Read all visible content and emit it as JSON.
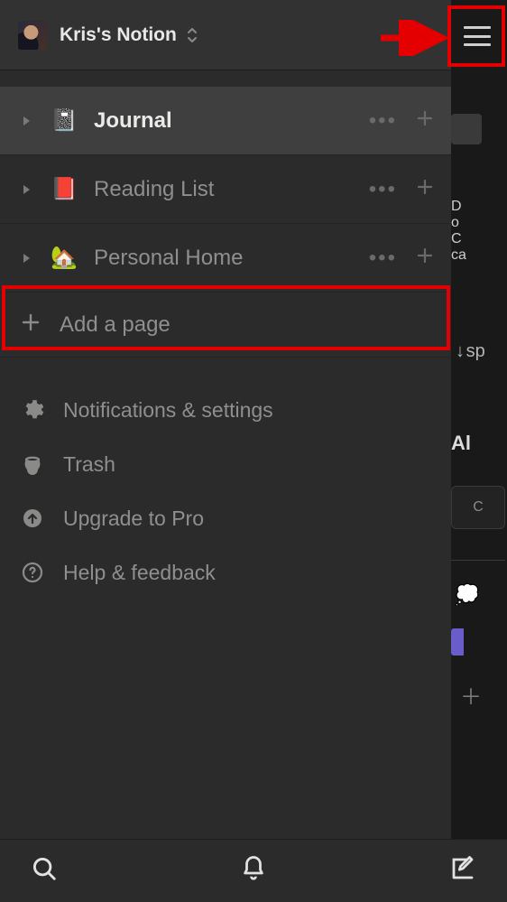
{
  "workspace": {
    "name": "Kris's Notion"
  },
  "pages": [
    {
      "icon": "📓",
      "label": "Journal",
      "selected": true
    },
    {
      "icon": "📕",
      "label": "Reading List",
      "selected": false
    },
    {
      "icon": "🏡",
      "label": "Personal Home",
      "selected": false
    }
  ],
  "addPage": {
    "label": "Add a page"
  },
  "utilities": [
    {
      "icon": "gear",
      "label": "Notifications & settings"
    },
    {
      "icon": "trash",
      "label": "Trash"
    },
    {
      "icon": "upgrade",
      "label": "Upgrade to Pro"
    },
    {
      "icon": "help",
      "label": "Help & feedback"
    }
  ],
  "peek": {
    "lines": [
      "D",
      "o",
      "C",
      "ca"
    ],
    "sp": "sp",
    "al": "Al",
    "boxChar": "C",
    "bubble": "💭"
  },
  "annotations": {
    "arrow_color": "#e40000"
  }
}
